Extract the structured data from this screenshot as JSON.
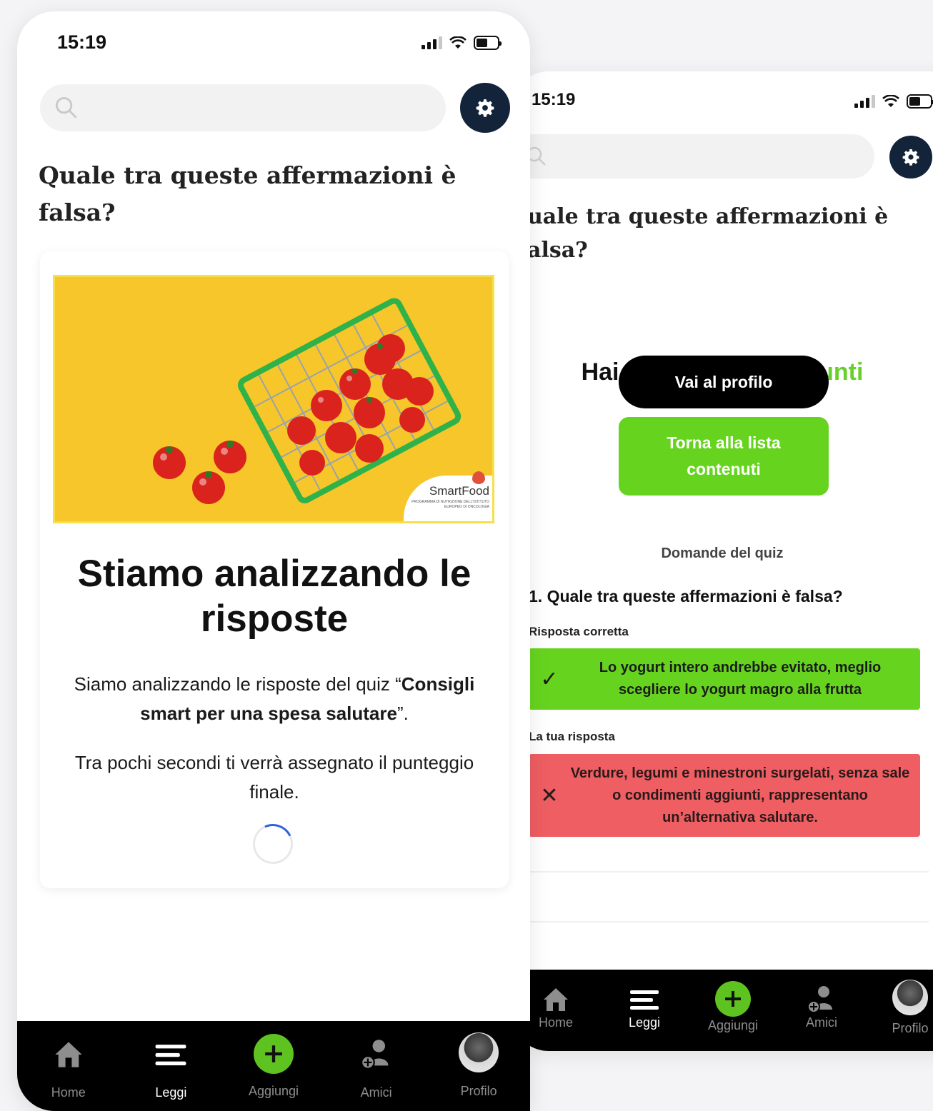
{
  "status": {
    "time": "15:19"
  },
  "front": {
    "search": {
      "placeholder": ""
    },
    "question_title": "Quale tra queste affermazioni è falsa?",
    "image": {
      "brand": "SmartFood",
      "brand_sub": "PROGRAMMA DI NUTRIZIONE DELL'ISTITUTO EUROPEO DI ONCOLOGIA"
    },
    "heading": "Stiamo analizzando le risposte",
    "p1_before": "Siamo analizzando le risposte del quiz “",
    "p1_bold": "Consigli smart per una spesa salutare",
    "p1_after": "”.",
    "p2": "Tra pochi secondi ti verrà assegnato il punteggio finale."
  },
  "back": {
    "question_title_line1": "uale tra queste affermazioni è",
    "question_title_line2": "alsa?",
    "earned_prefix": "Hai guadagnato",
    "earned_points": "10 punti",
    "profile_button": "Vai al profilo",
    "list_button": "Torna alla lista contenuti",
    "quiz_heading": "Domande del quiz",
    "quiz_question": "1. Quale tra queste affermazioni è falsa?",
    "correct_label": "Risposta corretta",
    "correct_answer": "Lo yogurt intero andrebbe evitato, meglio scegliere lo yogurt magro alla frutta",
    "your_label": "La tua risposta",
    "your_answer": "Verdure, legumi e minestroni surgelati, senza sale o condimenti aggiunti, rappresentano un’alternativa salutare."
  },
  "tabbar": {
    "items": [
      {
        "label": "Home",
        "icon": "home-icon"
      },
      {
        "label": "Leggi",
        "icon": "menu-lines-icon"
      },
      {
        "label": "Aggiungi",
        "icon": "plus-icon"
      },
      {
        "label": "Amici",
        "icon": "add-friend-icon"
      },
      {
        "label": "Profilo",
        "icon": "avatar"
      }
    ],
    "active": "Leggi"
  },
  "colors": {
    "accent_green": "#66d41f",
    "navy": "#132339",
    "wrong_red": "#ee5e62",
    "spinner_blue": "#2d64d8",
    "image_yellow": "#f7c62b"
  }
}
